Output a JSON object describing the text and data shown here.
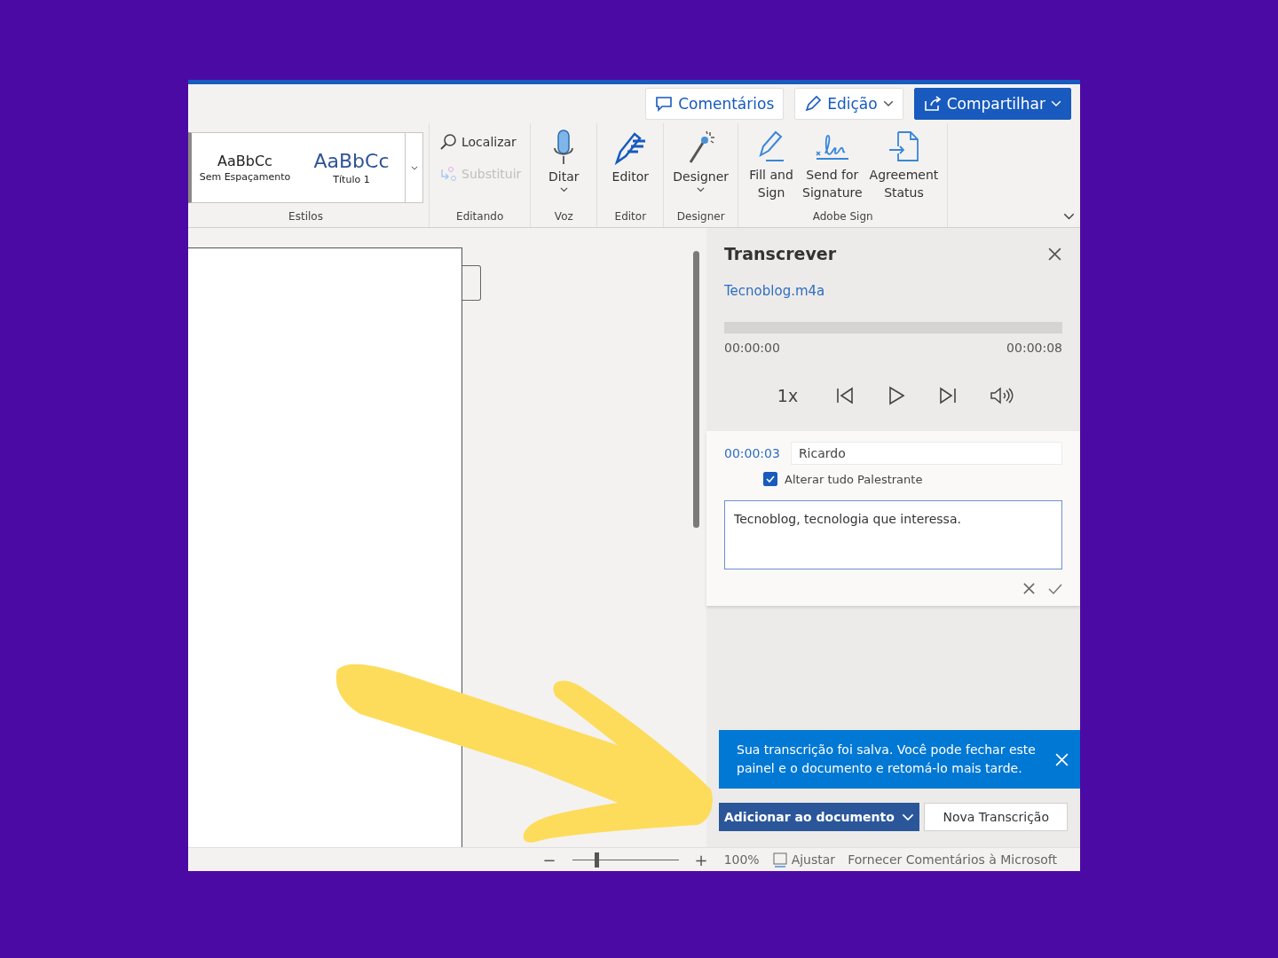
{
  "top_buttons": [
    {
      "label": "Comentários",
      "kind": "plain"
    },
    {
      "label": "Edição",
      "kind": "dropdown"
    },
    {
      "label": "Compartilhar",
      "kind": "primary"
    }
  ],
  "ribbon": {
    "styles": [
      {
        "sample": "AaBbCc",
        "name": "Sem Espaçamento",
        "kind": "normal"
      },
      {
        "sample": "AaBbCc",
        "name": "Título 1",
        "kind": "heading"
      }
    ],
    "styles_label": "Estilos",
    "groups": [
      {
        "label": "Editando",
        "kind": "small",
        "buttons": [
          {
            "label": "Localizar",
            "disabled": false
          },
          {
            "label": "Substituir",
            "disabled": true
          }
        ]
      },
      {
        "label": "Voz",
        "kind": "large",
        "buttons": [
          {
            "label": "Ditar",
            "dropdown": true
          }
        ]
      },
      {
        "label": "Editor",
        "kind": "large",
        "buttons": [
          {
            "label": "Editor",
            "dropdown": false
          }
        ]
      },
      {
        "label": "Designer",
        "kind": "large",
        "buttons": [
          {
            "label": "Designer",
            "dropdown": true
          }
        ]
      },
      {
        "label": "Adobe Sign",
        "kind": "large",
        "buttons": [
          {
            "label": "Fill and Sign",
            "dropdown": false
          },
          {
            "label": "Send for Signature",
            "dropdown": false
          },
          {
            "label": "Agreement Status",
            "dropdown": false
          }
        ]
      }
    ]
  },
  "panel": {
    "title": "Transcrever",
    "file": "Tecnoblog.m4a",
    "playback": {
      "start": "00:00:00",
      "end": "00:00:08",
      "speed": "1x"
    },
    "entry": {
      "time": "00:00:03",
      "speaker": "Ricardo",
      "change_all": {
        "label": "Alterar tudo Palestrante",
        "checked": true
      },
      "text": "Tecnoblog, tecnologia que interessa."
    },
    "notice": "Sua transcrição foi salva. Você pode fechar este painel e o documento e retomá-lo mais tarde.",
    "add_button": "Adicionar ao documento",
    "new_button": "Nova Transcrição"
  },
  "status_bar": {
    "zoom_out": "−",
    "zoom": {
      "level": 0.23
    },
    "zoom_in": "+",
    "percent": "100%",
    "fit": "Ajustar",
    "feedback": "Fornecer Comentários à Microsoft"
  }
}
